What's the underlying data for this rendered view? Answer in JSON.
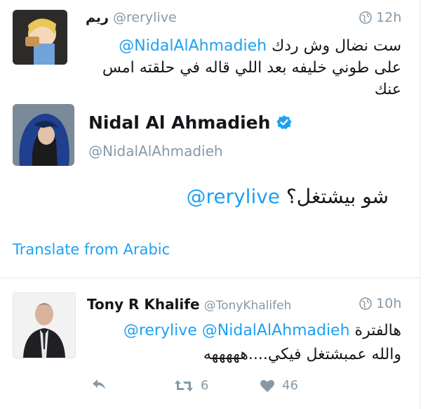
{
  "tweet1": {
    "name": "ريم",
    "handle": "@rerylive",
    "time": "12h",
    "mention": "@NidalAlAhmadieh",
    "line1_text": "ست نضال وش ردك",
    "line2": "على طوني خليفه بعد اللي قاله في حلقته امس",
    "line3": "عنك"
  },
  "tweet2": {
    "name": "Nidal Al Ahmadieh",
    "handle": "@NidalAlAhmadieh",
    "mention": "@rerylive",
    "text": "شو بيشتغل؟",
    "translate": "Translate from Arabic"
  },
  "tweet3": {
    "name": "Tony R Khalife",
    "handle": "@TonyKhalifeh",
    "time": "10h",
    "mention1": "@rerylive",
    "mention2": "@NidalAlAhmadieh",
    "line1_text": "هالفترة",
    "line2": "والله عمبشتغل فيكي....هههههه",
    "retweets": "6",
    "likes": "46"
  },
  "colors": {
    "link": "#1da1f2",
    "muted": "#8899a6",
    "verified": "#1da1f2"
  },
  "icons": [
    "globe-icon",
    "verified-badge-icon",
    "reply-icon",
    "retweet-icon",
    "heart-icon"
  ]
}
